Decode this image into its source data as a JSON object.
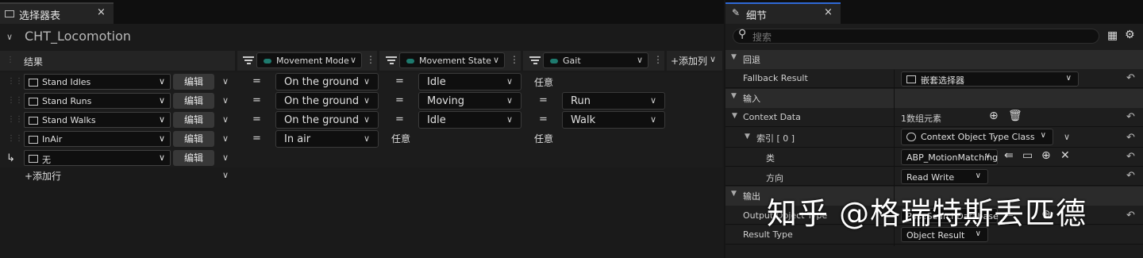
{
  "left_tab": {
    "title": "选择器表",
    "close": "×"
  },
  "table_name": "CHT_Locomotion",
  "columns": {
    "result": "结果",
    "movement_mode": "Movement Mode",
    "movement_state": "Movement State",
    "gait": "Gait",
    "add_column": "+添加列"
  },
  "rows": [
    {
      "result": "Stand Idles",
      "edit": "编辑",
      "op1": "=",
      "mode": "On the ground",
      "op2": "=",
      "state": "Idle",
      "gait": "任意"
    },
    {
      "result": "Stand Runs",
      "edit": "编辑",
      "op1": "=",
      "mode": "On the ground",
      "op2": "=",
      "state": "Moving",
      "op3": "=",
      "gait": "Run"
    },
    {
      "result": "Stand Walks",
      "edit": "编辑",
      "op1": "=",
      "mode": "On the ground",
      "op2": "=",
      "state": "Idle",
      "op3": "=",
      "gait": "Walk"
    },
    {
      "result": "InAir",
      "edit": "编辑",
      "op1": "=",
      "mode": "In air",
      "state": "任意",
      "gait": "任意"
    },
    {
      "result": "无",
      "edit": "编辑"
    }
  ],
  "add_row": "+添加行",
  "right_tab": {
    "title": "细节",
    "close": "×"
  },
  "search": {
    "placeholder": "搜索"
  },
  "sections": {
    "fallback": "回退",
    "input": "输入",
    "output": "输出"
  },
  "props": {
    "fallback_result_label": "Fallback Result",
    "fallback_result_value": "嵌套选择器",
    "context_data_label": "Context Data",
    "context_data_value": "1数组元素",
    "index_label": "索引 [ 0 ]",
    "index_value": "Context Object Type Class",
    "class_label": "类",
    "class_value": "ABP_MotionMatching",
    "direction_label": "方向",
    "direction_value": "Read Write",
    "output_object_type_label": "Output Object Type",
    "output_object_type_value": "PoseSearchDatabase",
    "result_type_label": "Result Type",
    "result_type_value": "Object Result"
  },
  "watermark": "知乎 @格瑞特斯丢匹德",
  "colors": {
    "accent": "#2f69d6",
    "pin": "#1e7a6e"
  }
}
